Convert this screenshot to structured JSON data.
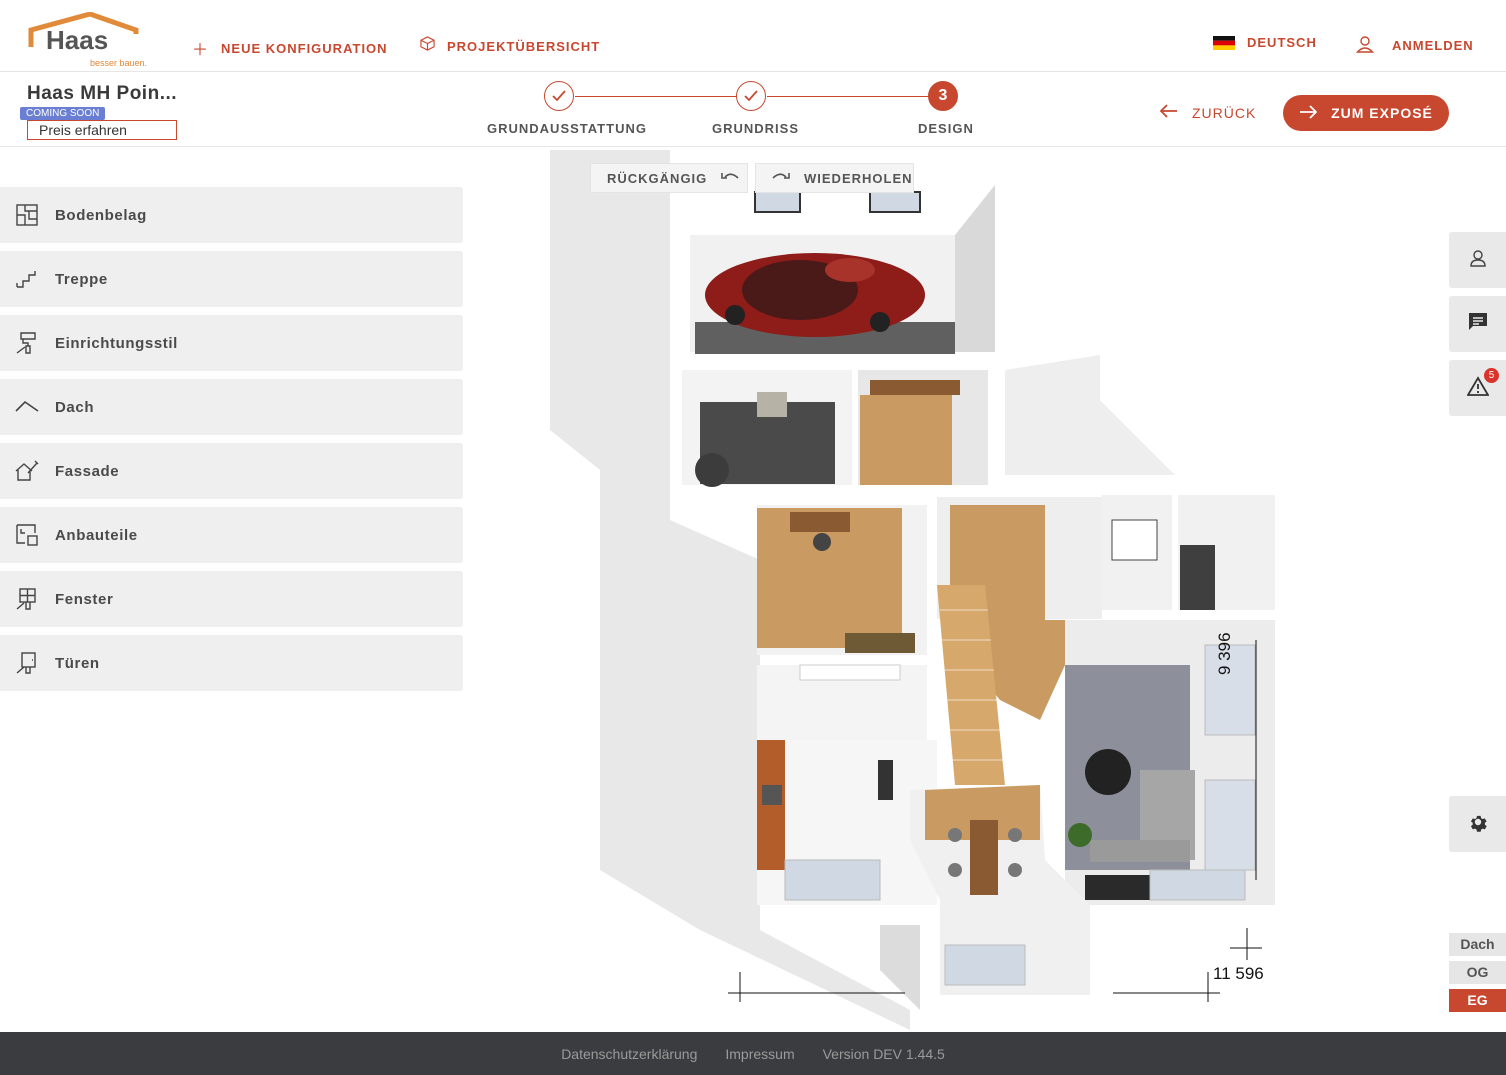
{
  "header": {
    "logo_text": "Haas",
    "logo_tagline": "besser bauen.",
    "new_config_label": "NEUE KONFIGURATION",
    "project_overview_label": "PROJEKTÜBERSICHT",
    "language_label": "DEUTSCH",
    "login_label": "ANMELDEN"
  },
  "project": {
    "title": "Haas MH Poin...",
    "badge": "COMING SOON",
    "price_button": "Preis erfahren"
  },
  "steps": [
    {
      "label": "GRUNDAUSSTATTUNG",
      "state": "done"
    },
    {
      "label": "GRUNDRISS",
      "state": "done"
    },
    {
      "label": "DESIGN",
      "state": "active",
      "number": "3"
    }
  ],
  "actions": {
    "back_label": "ZURÜCK",
    "expose_label": "ZUM EXPOSÉ"
  },
  "sidebar": {
    "items": [
      {
        "label": "Bodenbelag",
        "icon": "floor-plan-icon"
      },
      {
        "label": "Treppe",
        "icon": "stairs-icon"
      },
      {
        "label": "Einrichtungsstil",
        "icon": "brush-icon"
      },
      {
        "label": "Dach",
        "icon": "roof-icon"
      },
      {
        "label": "Fassade",
        "icon": "facade-brush-icon"
      },
      {
        "label": "Anbauteile",
        "icon": "extension-icon"
      },
      {
        "label": "Fenster",
        "icon": "window-brush-icon"
      },
      {
        "label": "Türen",
        "icon": "door-brush-icon"
      }
    ]
  },
  "toolbar": {
    "undo_label": "RÜCKGÄNGIG",
    "redo_label": "WIEDERHOLEN"
  },
  "right_panel": {
    "notification_count": "5",
    "levels": [
      "Dach",
      "OG",
      "EG"
    ],
    "active_level": "EG"
  },
  "plan": {
    "dimension_vertical": "9 396",
    "dimension_horizontal": "11 596"
  },
  "footer": {
    "privacy": "Datenschutzerklärung",
    "imprint": "Impressum",
    "version": "Version DEV 1.44.5"
  },
  "colors": {
    "accent": "#c8472f",
    "badge": "#6a7fd4",
    "footer_bg": "#3b3c40",
    "sidebar_bg": "#efefef",
    "wood": "#c99a62",
    "car": "#8e1c18"
  }
}
